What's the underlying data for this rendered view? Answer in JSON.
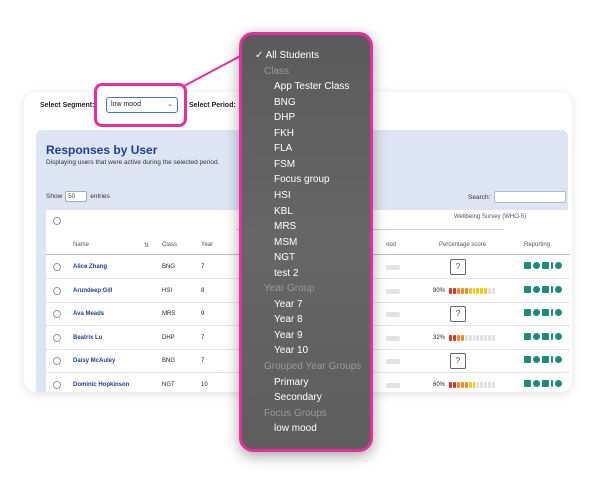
{
  "topbar": {
    "segment_label": "Select Segment:",
    "segment_value": "low mood",
    "period_label": "Select Period:"
  },
  "panel": {
    "title": "Responses by User",
    "subtitle": "Displaying users that were active during the selected period.",
    "show_label": "Show",
    "show_value": "50",
    "entries_label": "entries",
    "search_label": "Search:"
  },
  "table": {
    "group_header": "Wellbeing Survey (WHO-5)",
    "columns": {
      "name": "Name",
      "class": "Class",
      "year": "Year",
      "mood": "ood",
      "percentage": "Percentage score",
      "reporting": "Reporting"
    },
    "rows": [
      {
        "name": "Alice Zhang",
        "class": "BNG",
        "year": "7",
        "pct": "",
        "score": null
      },
      {
        "name": "Arundeep Gill",
        "class": "HSI",
        "year": "8",
        "pct": "80%",
        "score": 0.8
      },
      {
        "name": "Ava Meads",
        "class": "MRS",
        "year": "9",
        "pct": "",
        "score": null
      },
      {
        "name": "Beatrix Lu",
        "class": "DHP",
        "year": "7",
        "pct": "32%",
        "score": 0.32
      },
      {
        "name": "Daisy McAuley",
        "class": "BNG",
        "year": "7",
        "pct": "",
        "score": null
      },
      {
        "name": "Dominic Hopkinson",
        "class": "NGT",
        "year": "10",
        "pct": "60%",
        "score": 0.6
      }
    ]
  },
  "dropdown": {
    "items": [
      {
        "type": "checked",
        "label": "✓ All Students"
      },
      {
        "type": "group",
        "label": "Class"
      },
      {
        "type": "opt",
        "label": "App Tester Class"
      },
      {
        "type": "opt",
        "label": "BNG"
      },
      {
        "type": "opt",
        "label": "DHP"
      },
      {
        "type": "opt",
        "label": "FKH"
      },
      {
        "type": "opt",
        "label": "FLA"
      },
      {
        "type": "opt",
        "label": "FSM"
      },
      {
        "type": "opt",
        "label": "Focus group"
      },
      {
        "type": "opt",
        "label": "HSI"
      },
      {
        "type": "opt",
        "label": "KBL"
      },
      {
        "type": "opt",
        "label": "MRS"
      },
      {
        "type": "opt",
        "label": "MSM"
      },
      {
        "type": "opt",
        "label": "NGT"
      },
      {
        "type": "opt",
        "label": "test 2"
      },
      {
        "type": "group",
        "label": "Year Group"
      },
      {
        "type": "opt",
        "label": "Year 7"
      },
      {
        "type": "opt",
        "label": "Year 8"
      },
      {
        "type": "opt",
        "label": "Year 9"
      },
      {
        "type": "opt",
        "label": "Year 10"
      },
      {
        "type": "group",
        "label": "Grouped Year Groups"
      },
      {
        "type": "opt",
        "label": "Primary"
      },
      {
        "type": "opt",
        "label": "Secondary"
      },
      {
        "type": "group",
        "label": "Focus Groups"
      },
      {
        "type": "opt",
        "label": "low mood"
      }
    ]
  },
  "colors": {
    "highlight": "#e62ea0",
    "title_blue": "#1c3f97",
    "icon_teal": "#1d8a7a",
    "bar_red": "#d9342b",
    "bar_orange": "#f08a24",
    "bar_yellow": "#f5c518"
  }
}
